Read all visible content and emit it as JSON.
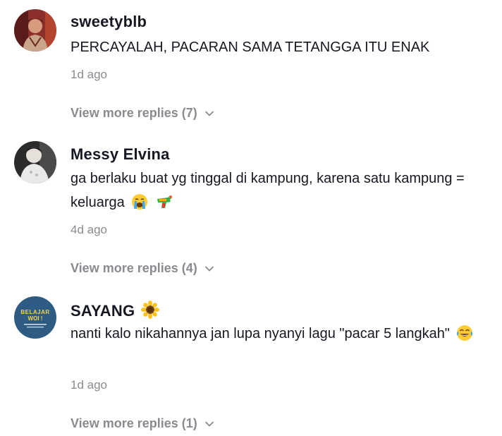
{
  "comments": [
    {
      "username": "sweetyblb",
      "text": "PERCAYALAH, PACARAN SAMA TETANGGA ITU ENAK",
      "time": "1d ago",
      "more_replies": "View more replies (7)"
    },
    {
      "username": "Messy Elvina",
      "text": "ga berlaku buat yg tinggal di kampung, karena satu kampung = keluarga",
      "time": "4d ago",
      "more_replies": "View more replies (4)"
    },
    {
      "username": "SAYANG",
      "text": "nanti kalo nikahannya jan lupa nyanyi lagu \"pacar 5 langkah\"",
      "time": "1d ago",
      "more_replies": "View more replies (1)",
      "avatar_text": "BELAJAR WOI !"
    }
  ],
  "colors": {
    "primary_text": "#161823",
    "secondary_text": "#8a8b91",
    "avatar3_bg": "#2e5b82",
    "avatar3_text": "#f5d34a"
  }
}
